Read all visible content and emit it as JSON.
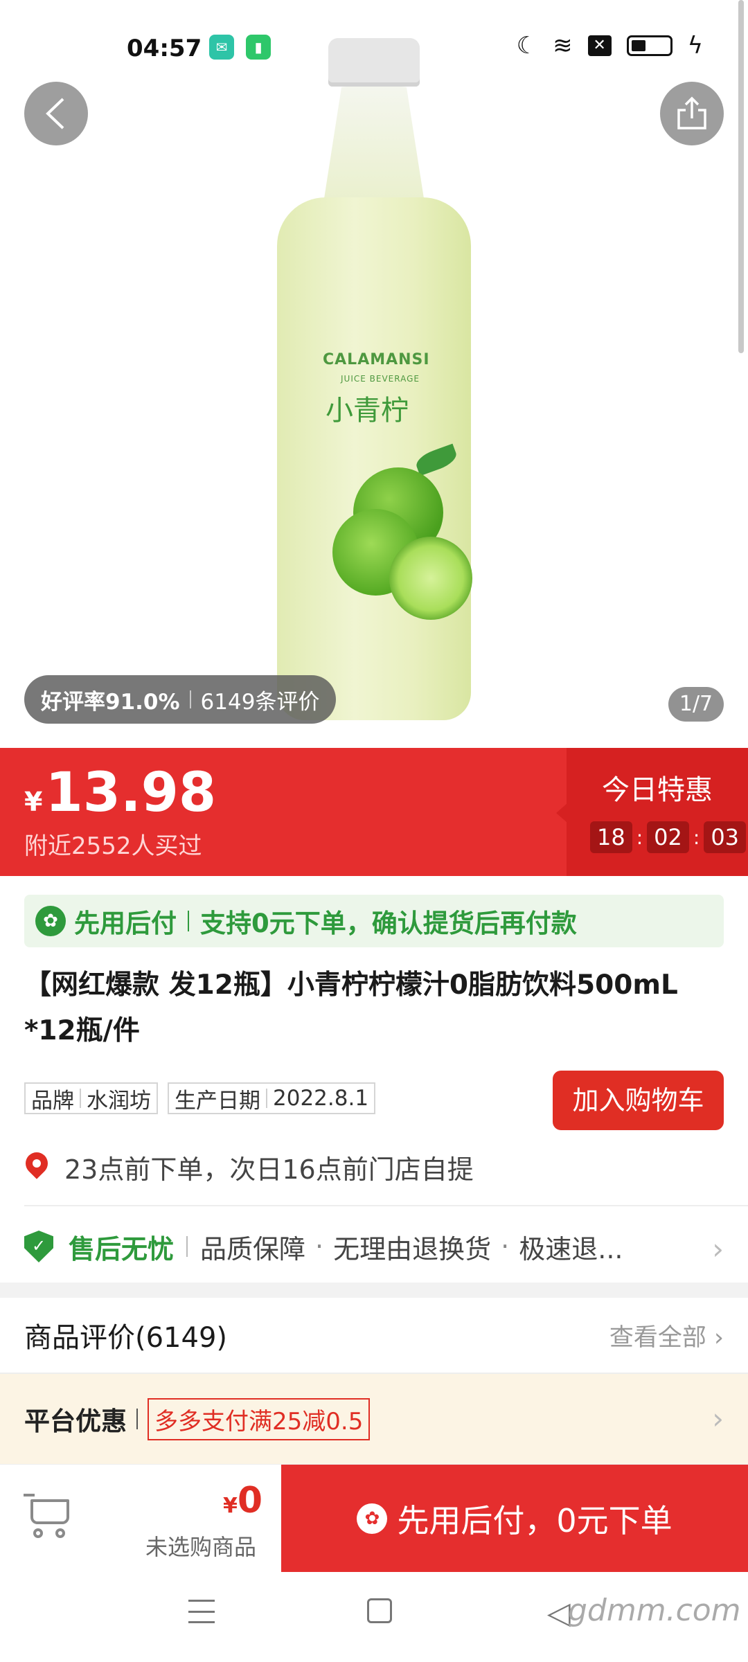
{
  "status_bar": {
    "time": "04:57"
  },
  "hero": {
    "bottle_label": {
      "brand_en": "CALAMANSI",
      "brand_sub": "JUICE BEVERAGE",
      "brand_cn": "小青柠"
    },
    "rating": {
      "good_rate": "好评率91.0%",
      "review_count": "6149条评价"
    },
    "image_counter": "1/7"
  },
  "price": {
    "symbol": "¥",
    "value": "13.98",
    "buyers": "附近2552人买过",
    "deal_title": "今日特惠",
    "timer": {
      "h": "18",
      "m": "02",
      "s": "03"
    }
  },
  "paylater": {
    "label": "先用后付",
    "desc": "支持0元下单，确认提货后再付款"
  },
  "product": {
    "title": "【网红爆款 发12瓶】小青柠柠檬汁0脂肪饮料500mL *12瓶/件",
    "tags": [
      {
        "key": "品牌",
        "value": "水润坊"
      },
      {
        "key": "生产日期",
        "value": "2022.8.1"
      }
    ],
    "add_to_cart": "加入购物车",
    "pickup": "23点前下单，次日16点前门店自提"
  },
  "aftersale": {
    "label": "售后无忧",
    "items": [
      "品质保障",
      "无理由退换货",
      "极速退..."
    ]
  },
  "reviews": {
    "title": "商品评价(6149)",
    "view_all": "查看全部"
  },
  "promo": {
    "label": "平台优惠",
    "coupon": "多多支付满25减0.5"
  },
  "bottom_bar": {
    "currency": "¥",
    "total": "0",
    "note": "未选购商品",
    "buy_label": "先用后付，0元下单"
  },
  "watermark": "gdmm.com",
  "colors": {
    "accent_red": "#e52e2e",
    "green": "#2e9a3c",
    "promo_bg": "#fcf4e4"
  }
}
